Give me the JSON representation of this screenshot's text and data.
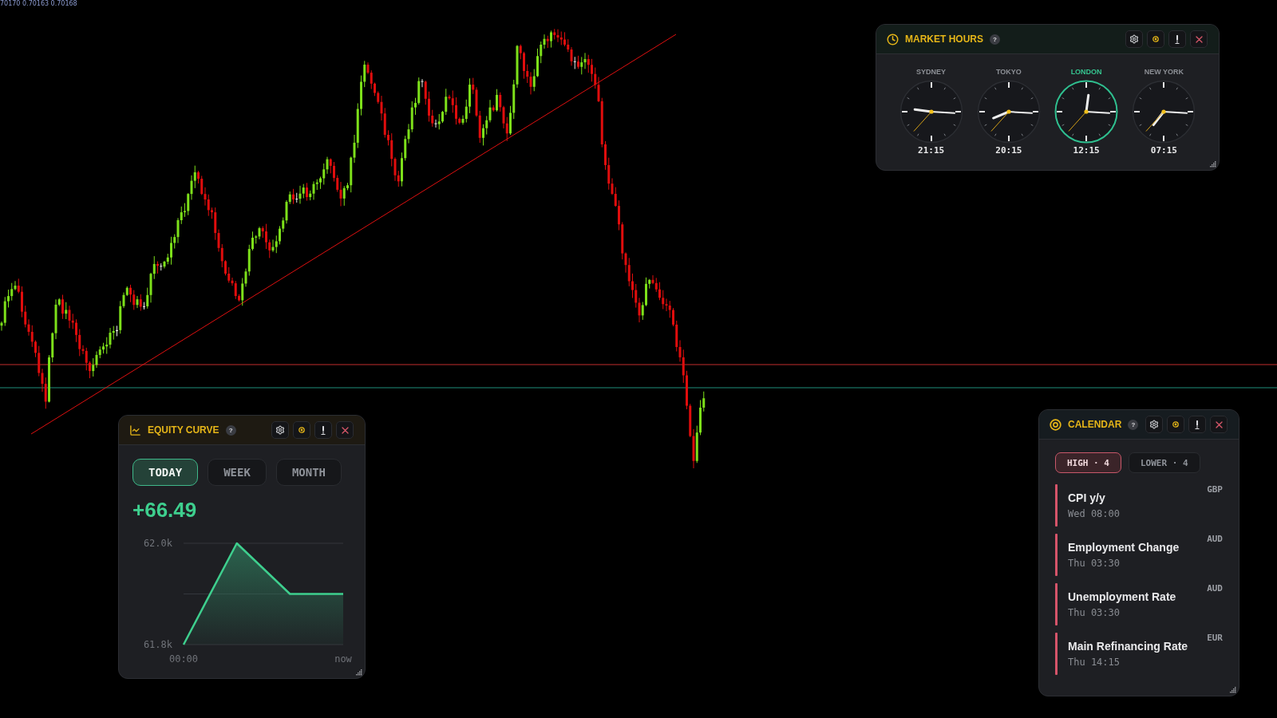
{
  "chart": {
    "readout": "70170 0.70163 0.70168"
  },
  "market_hours": {
    "title": "MARKET HOURS",
    "help": "?",
    "clocks": [
      {
        "city": "SYDNEY",
        "time": "21:15",
        "active": false
      },
      {
        "city": "TOKYO",
        "time": "20:15",
        "active": false
      },
      {
        "city": "LONDON",
        "time": "12:15",
        "active": true
      },
      {
        "city": "NEW YORK",
        "time": "07:15",
        "active": false
      }
    ]
  },
  "equity_curve": {
    "title": "EQUITY CURVE",
    "help": "?",
    "tabs": [
      {
        "label": "TODAY",
        "selected": true
      },
      {
        "label": "WEEK",
        "selected": false
      },
      {
        "label": "MONTH",
        "selected": false
      }
    ],
    "change": "+66.49",
    "chart_data": {
      "type": "area",
      "categories": [
        "00:00",
        null,
        null,
        "now"
      ],
      "values": [
        61.8,
        62.0,
        61.9,
        61.9
      ],
      "ylim": [
        61.8,
        62.0
      ],
      "yticks": [
        {
          "value": 61.8,
          "label": "61.8k"
        },
        {
          "value": 62.0,
          "label": "62.0k"
        }
      ],
      "ref_lines": [
        {
          "axis": "y",
          "value": 61.9
        }
      ]
    }
  },
  "calendar": {
    "title": "CALENDAR",
    "help": "?",
    "filters": [
      {
        "label": "HIGH · 4",
        "selected": true
      },
      {
        "label": "LOWER · 4",
        "selected": false
      }
    ],
    "events": [
      {
        "name": "CPI y/y",
        "time": "Wed 08:00",
        "currency": "GBP"
      },
      {
        "name": "Employment Change",
        "time": "Thu 03:30",
        "currency": "AUD"
      },
      {
        "name": "Unemployment Rate",
        "time": "Thu 03:30",
        "currency": "AUD"
      },
      {
        "name": "Main Refinancing Rate",
        "time": "Thu 14:15",
        "currency": "EUR"
      }
    ]
  }
}
